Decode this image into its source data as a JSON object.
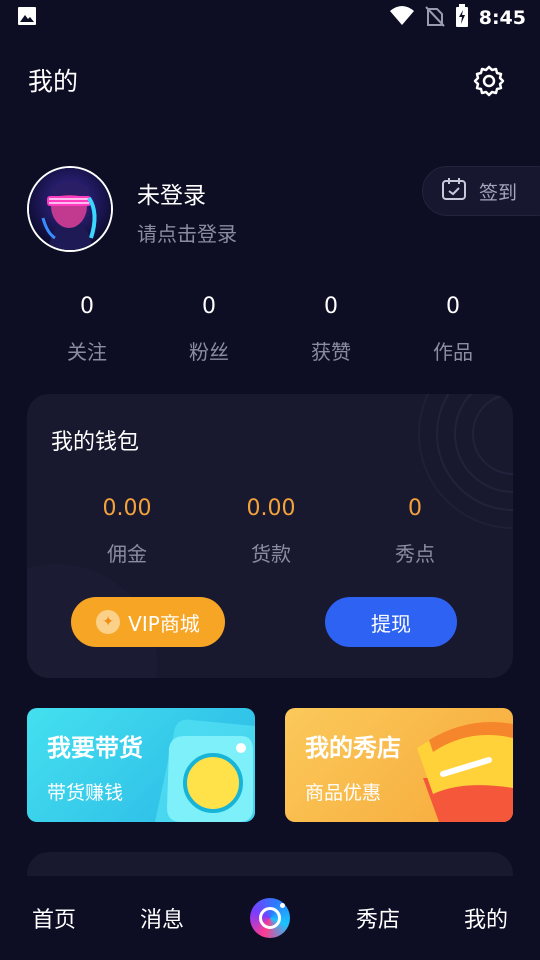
{
  "status_bar": {
    "time": "8:45",
    "icons": [
      "image-icon",
      "wifi-icon",
      "no-sim-icon",
      "battery-charging-icon"
    ]
  },
  "header": {
    "title": "我的",
    "settings_icon": "gear-icon"
  },
  "profile": {
    "name": "未登录",
    "subtitle": "请点击登录",
    "checkin_label": "签到",
    "checkin_icon": "calendar-check-icon"
  },
  "stats": [
    {
      "value": "0",
      "label": "关注"
    },
    {
      "value": "0",
      "label": "粉丝"
    },
    {
      "value": "0",
      "label": "获赞"
    },
    {
      "value": "0",
      "label": "作品"
    }
  ],
  "wallet": {
    "title": "我的钱包",
    "items": [
      {
        "value": "0.00",
        "label": "佣金"
      },
      {
        "value": "0.00",
        "label": "货款"
      },
      {
        "value": "0",
        "label": "秀点"
      }
    ],
    "vip_label": "VIP商城",
    "withdraw_label": "提现"
  },
  "promos": [
    {
      "title": "我要带货",
      "subtitle": "带货赚钱"
    },
    {
      "title": "我的秀店",
      "subtitle": "商品优惠"
    }
  ],
  "bottom_nav": {
    "items": [
      "首页",
      "消息",
      "秀店",
      "我的"
    ],
    "center_icon": "camera-ring-icon"
  },
  "colors": {
    "background": "#0d0d24",
    "card": "#18182f",
    "accent_orange": "#f6a524",
    "accent_blue": "#2d62f2",
    "value_orange": "#f4a23c"
  }
}
